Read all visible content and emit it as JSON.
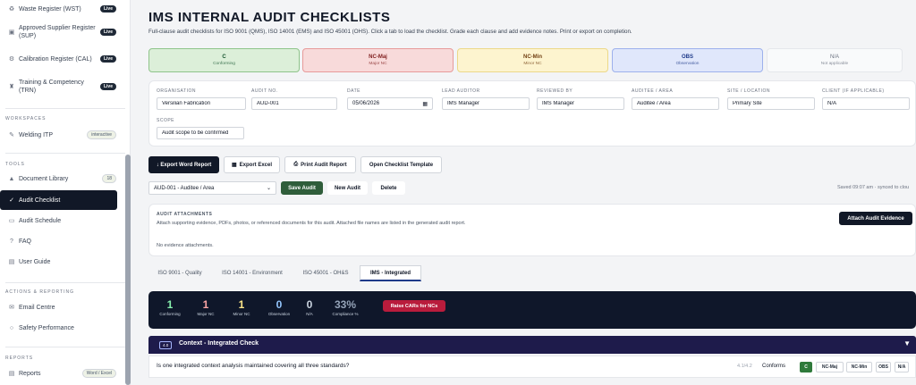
{
  "sidebar": {
    "items_top": [
      {
        "label": "Waste Register (WST)",
        "badge": "Live"
      },
      {
        "label": "Approved Supplier Register (SUP)",
        "badge": "Live"
      },
      {
        "label": "Calibration Register (CAL)",
        "badge": "Live"
      },
      {
        "label": "Training & Competency (TRN)",
        "badge": "Live"
      }
    ],
    "workspaces_head": "WORKSPACES",
    "welding": {
      "label": "Welding ITP",
      "badge": "interactive"
    },
    "tools_head": "TOOLS",
    "tools": [
      {
        "label": "Document Library",
        "badge": "18",
        "icon": "▲"
      },
      {
        "label": "Audit Checklist",
        "icon": "✓"
      },
      {
        "label": "Audit Schedule",
        "icon": "▭"
      },
      {
        "label": "FAQ",
        "icon": "?"
      },
      {
        "label": "User Guide",
        "icon": "▤"
      }
    ],
    "actions_head": "ACTIONS & REPORTING",
    "actions": [
      {
        "label": "Email Centre",
        "icon": "✉"
      },
      {
        "label": "Safety Performance",
        "icon": "○"
      }
    ],
    "reports_head": "REPORTS",
    "reports": {
      "label": "Reports",
      "badge": "Word / Excel",
      "icon": "▤"
    }
  },
  "page": {
    "title": "IMS INTERNAL AUDIT CHECKLISTS",
    "subtitle": "Full-clause audit checklists for ISO 9001 (QMS), ISO 14001 (EMS) and ISO 45001 (OHS). Click a tab to load the checklist. Grade each clause and add evidence notes. Print or export on completion."
  },
  "grades": [
    {
      "code": "C",
      "desc": "Conforming",
      "bg": "#dcefd9",
      "border": "#8fc48a",
      "color": "#14532d"
    },
    {
      "code": "NC-Maj",
      "desc": "Major NC",
      "bg": "#f8dada",
      "border": "#e79a9a",
      "color": "#7f1d1d"
    },
    {
      "code": "NC-Min",
      "desc": "Minor NC",
      "bg": "#fdf4cf",
      "border": "#ecd889",
      "color": "#713f12"
    },
    {
      "code": "OBS",
      "desc": "Observation",
      "bg": "#e0e7fb",
      "border": "#9db1ec",
      "color": "#1e3a8a"
    },
    {
      "code": "N/A",
      "desc": "Not applicable",
      "bg": "#f9fafb",
      "border": "#e5e7eb",
      "color": "#6b7280"
    }
  ],
  "form": {
    "organisation": {
      "label": "ORGANISATION",
      "value": "Versilian Fabrication"
    },
    "audit_no": {
      "label": "AUDIT NO.",
      "value": "AUD-001"
    },
    "date": {
      "label": "DATE",
      "value": "05/06/2026"
    },
    "lead_auditor": {
      "label": "LEAD AUDITOR",
      "value": "IMS Manager"
    },
    "reviewed_by": {
      "label": "REVIEWED BY",
      "value": "IMS Manager"
    },
    "auditee": {
      "label": "AUDITEE / AREA",
      "value": "Auditee / Area"
    },
    "site": {
      "label": "SITE / LOCATION",
      "value": "Primary Site"
    },
    "client": {
      "label": "CLIENT (IF APPLICABLE)",
      "value": "N/A"
    },
    "scope": {
      "label": "SCOPE",
      "value": "Audit scope to be confirmed"
    }
  },
  "actions": {
    "export_word": "↓ Export Word Report",
    "export_excel": "Export Excel",
    "print": "Print Audit Report",
    "open_template": "Open Checklist Template"
  },
  "audit_select": {
    "value": "AUD-001 - Auditee / Area"
  },
  "save": "Save Audit",
  "new": "New Audit",
  "delete": "Delete",
  "saved_status": "Saved 09:07 am · synced to clou",
  "attachments": {
    "head": "AUDIT ATTACHMENTS",
    "desc": "Attach supporting evidence, PDFs, photos, or referenced documents for this audit. Attached file names are listed in the generated audit report.",
    "empty": "No evidence attachments.",
    "button": "Attach Audit Evidence"
  },
  "tabs": [
    "ISO 9001 - Quality",
    "ISO 14001 - Environment",
    "ISO 45001 - OH&S",
    "IMS - Integrated"
  ],
  "stats": [
    {
      "value": "1",
      "label": "Conforming",
      "color": "#86efac"
    },
    {
      "value": "1",
      "label": "Major NC",
      "color": "#fca5a5"
    },
    {
      "value": "1",
      "label": "Minor NC",
      "color": "#fde68a"
    },
    {
      "value": "0",
      "label": "Observation",
      "color": "#93c5fd"
    },
    {
      "value": "0",
      "label": "N/A",
      "color": "#cbd5e1"
    },
    {
      "value": "33%",
      "label": "Compliance %",
      "color": "#94a3b8"
    }
  ],
  "raise_car": "Raise CARs for NCs",
  "category": {
    "num": "4.0",
    "title": "Context - Integrated Check",
    "toggle": "▼"
  },
  "question": {
    "text": "Is one integrated context analysis maintained covering all three standards?",
    "ref": "4.1/4.2",
    "status": "Conforms",
    "buttons": [
      "C",
      "NC-Maj",
      "NC-Min",
      "OBS",
      "N/A"
    ]
  }
}
